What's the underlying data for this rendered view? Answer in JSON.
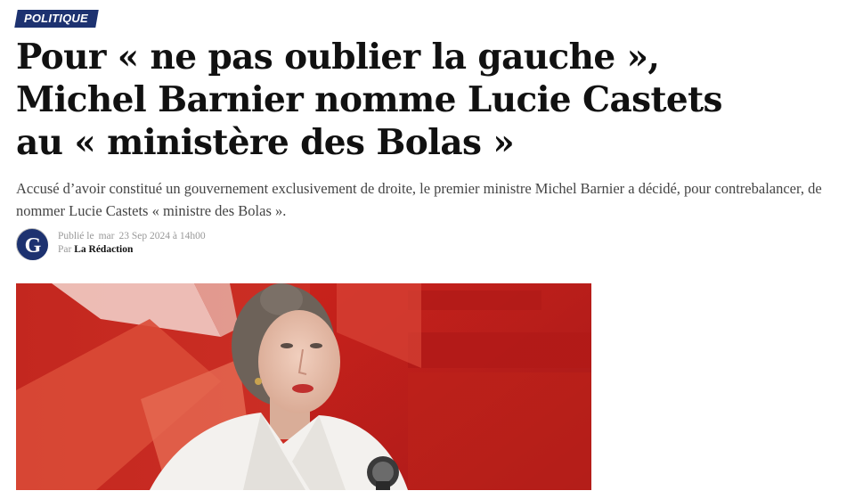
{
  "article": {
    "category": "POLITIQUE",
    "headline_lines": [
      "Pour « ne pas oublier la gauche »,",
      "Michel Barnier nomme Lucie Castets",
      "au « ministère des Bolas »"
    ],
    "lede_lines": [
      "Accusé d’avoir constitué un gouvernement exclusivement de droite, le premier ministre Michel Barnier a décidé, pour contrebalancer, de",
      "nommer Lucie Castets « ministre des Bolas »."
    ],
    "byline": {
      "avatar_letter": "G",
      "published_label": "Publié le",
      "day": "mar",
      "date": "23 Sep 2024 à 14h00",
      "by_label": "Par",
      "author": "La Rédaction"
    },
    "hero_image": {
      "icon": "hero-photo",
      "colors": {
        "background": "#b81f1f",
        "panel": "#d43a2f",
        "shirt": "#f3f1ee",
        "hair": "#6d6259"
      }
    }
  },
  "colors": {
    "brand": "#1d3270",
    "headline": "#111111",
    "lede": "#444444",
    "meta": "#999999"
  }
}
